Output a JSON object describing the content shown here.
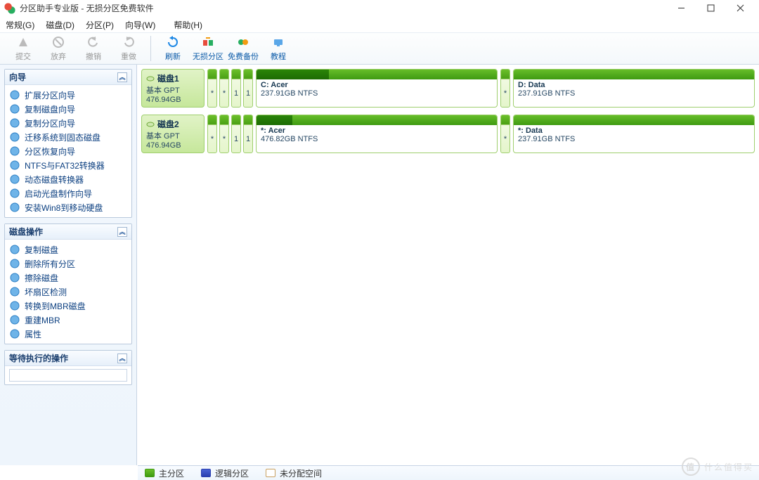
{
  "title": "分区助手专业版 - 无损分区免费软件",
  "window": {
    "min": "—",
    "max": "☐",
    "close": "✕"
  },
  "menu": [
    "常规(G)",
    "磁盘(D)",
    "分区(P)",
    "向导(W)",
    "帮助(H)"
  ],
  "toolbar": [
    {
      "label": "提交",
      "enabled": false,
      "icon": "commit"
    },
    {
      "label": "放弃",
      "enabled": false,
      "icon": "discard"
    },
    {
      "label": "撤销",
      "enabled": false,
      "icon": "undo"
    },
    {
      "label": "重做",
      "enabled": false,
      "icon": "redo"
    },
    {
      "sep": true
    },
    {
      "label": "刷新",
      "enabled": true,
      "icon": "refresh"
    },
    {
      "label": "无损分区",
      "enabled": true,
      "icon": "lossless"
    },
    {
      "label": "免费备份",
      "enabled": true,
      "icon": "backup"
    },
    {
      "label": "教程",
      "enabled": true,
      "icon": "tutorial"
    }
  ],
  "sidebar": {
    "wizard": {
      "title": "向导",
      "items": [
        "扩展分区向导",
        "复制磁盘向导",
        "复制分区向导",
        "迁移系统到固态磁盘",
        "分区恢复向导",
        "NTFS与FAT32转换器",
        "动态磁盘转换器",
        "启动光盘制作向导",
        "安装Win8到移动硬盘"
      ]
    },
    "diskops": {
      "title": "磁盘操作",
      "items": [
        "复制磁盘",
        "删除所有分区",
        "擦除磁盘",
        "坏扇区检测",
        "转换到MBR磁盘",
        "重建MBR",
        "属性"
      ]
    },
    "pending": {
      "title": "等待执行的操作"
    }
  },
  "disks": [
    {
      "name": "磁盘1",
      "type": "基本 GPT",
      "size": "476.94GB",
      "slots": [
        "*",
        "*",
        "1",
        "1"
      ],
      "partitions": [
        {
          "name": "C: Acer",
          "size": "237.91GB NTFS",
          "used": 30
        },
        {
          "name": "D: Data",
          "size": "237.91GB NTFS",
          "used": 0,
          "slot": "*"
        }
      ]
    },
    {
      "name": "磁盘2",
      "type": "基本 GPT",
      "size": "476.94GB",
      "slots": [
        "*",
        "*",
        "1",
        "1"
      ],
      "partitions": [
        {
          "name": "*: Acer",
          "size": "476.82GB NTFS",
          "used": 15
        },
        {
          "name": "*: Data",
          "size": "237.91GB NTFS",
          "used": 0,
          "slot": "*"
        }
      ]
    }
  ],
  "legend": {
    "primary": "主分区",
    "logical": "逻辑分区",
    "unalloc": "未分配空间"
  },
  "watermark": "什么值得买"
}
